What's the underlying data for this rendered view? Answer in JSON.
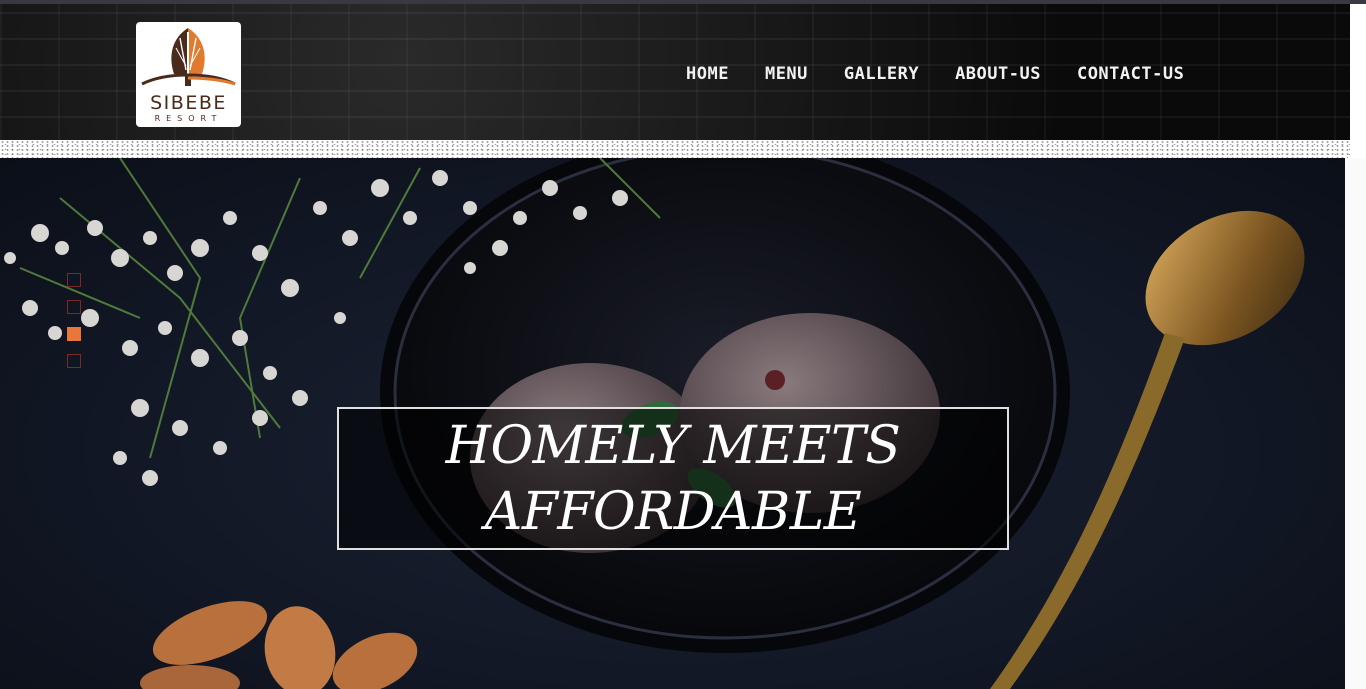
{
  "header": {
    "logo": {
      "name": "SIBEBE",
      "sub": "RESORT"
    },
    "nav": [
      {
        "label": "HOME"
      },
      {
        "label": "MENU"
      },
      {
        "label": "GALLERY"
      },
      {
        "label": "ABOUT-US"
      },
      {
        "label": "CONTACT-US"
      }
    ]
  },
  "hero": {
    "headline_line1": "HOMELY MEETS",
    "headline_line2": "AFFORDABLE",
    "slides": {
      "count": 4,
      "active_index": 2
    }
  },
  "colors": {
    "accent": "#e9773c",
    "dot_border": "#7a2a22",
    "header_bg": "#0c0c0c",
    "logo_brown": "#4a2a1c"
  },
  "icons": {
    "logo_mark": "flame-shield-icon"
  }
}
